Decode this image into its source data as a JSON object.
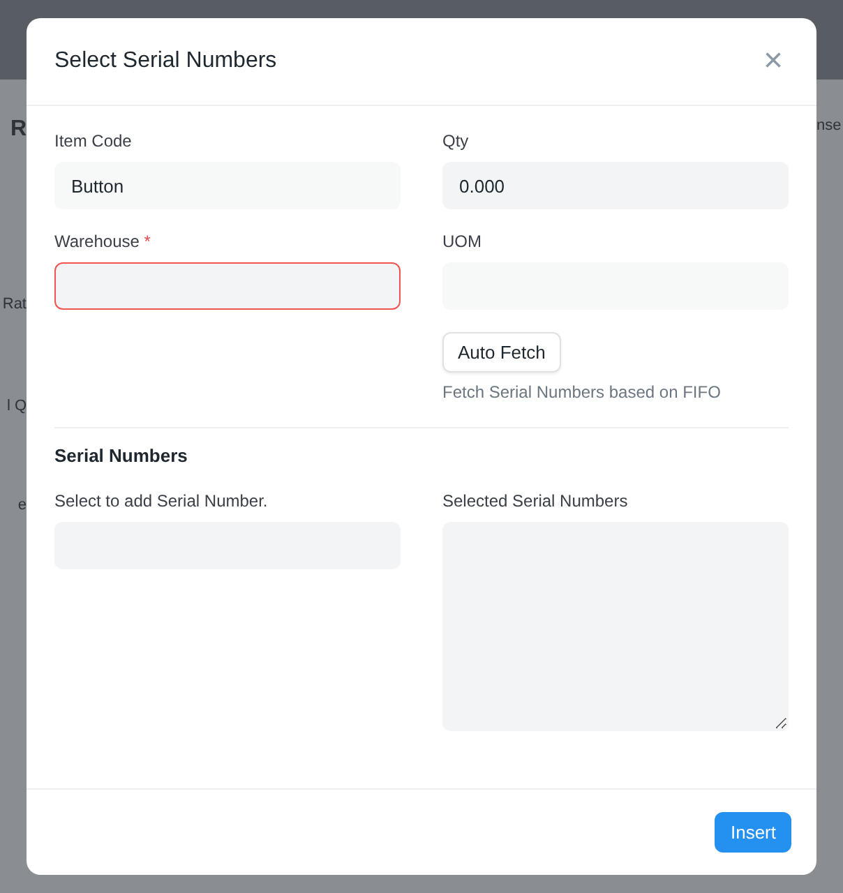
{
  "backdrop": {
    "left_fragments": [
      {
        "text": "R",
        "bold": true
      },
      {
        "text": "Rat",
        "bold": false
      },
      {
        "text": "l Q",
        "bold": false
      },
      {
        "text": "e",
        "bold": false
      }
    ],
    "right_fragments": [
      {
        "text": "nse",
        "bold": false
      }
    ]
  },
  "dialog": {
    "title": "Select Serial Numbers",
    "close": "×",
    "fields": [
      {
        "label": "Item Code",
        "value": "Button",
        "invalid": false
      },
      {
        "label": "Qty",
        "value": "0.000",
        "invalid": false
      },
      {
        "label": "Warehouse",
        "required_mark": "*",
        "invalid": true
      },
      {
        "label": "UOM",
        "invalid": false
      }
    ],
    "fetch_button": "Auto Fetch",
    "fetch_hint": "Fetch Serial Numbers based on FIFO",
    "section_title": "Serial Numbers",
    "serial_fields": [
      {
        "label": "Select to add Serial Number.",
        "kind": "input"
      },
      {
        "label": "Selected Serial Numbers",
        "kind": "textarea"
      }
    ],
    "primary_button": "Insert"
  }
}
